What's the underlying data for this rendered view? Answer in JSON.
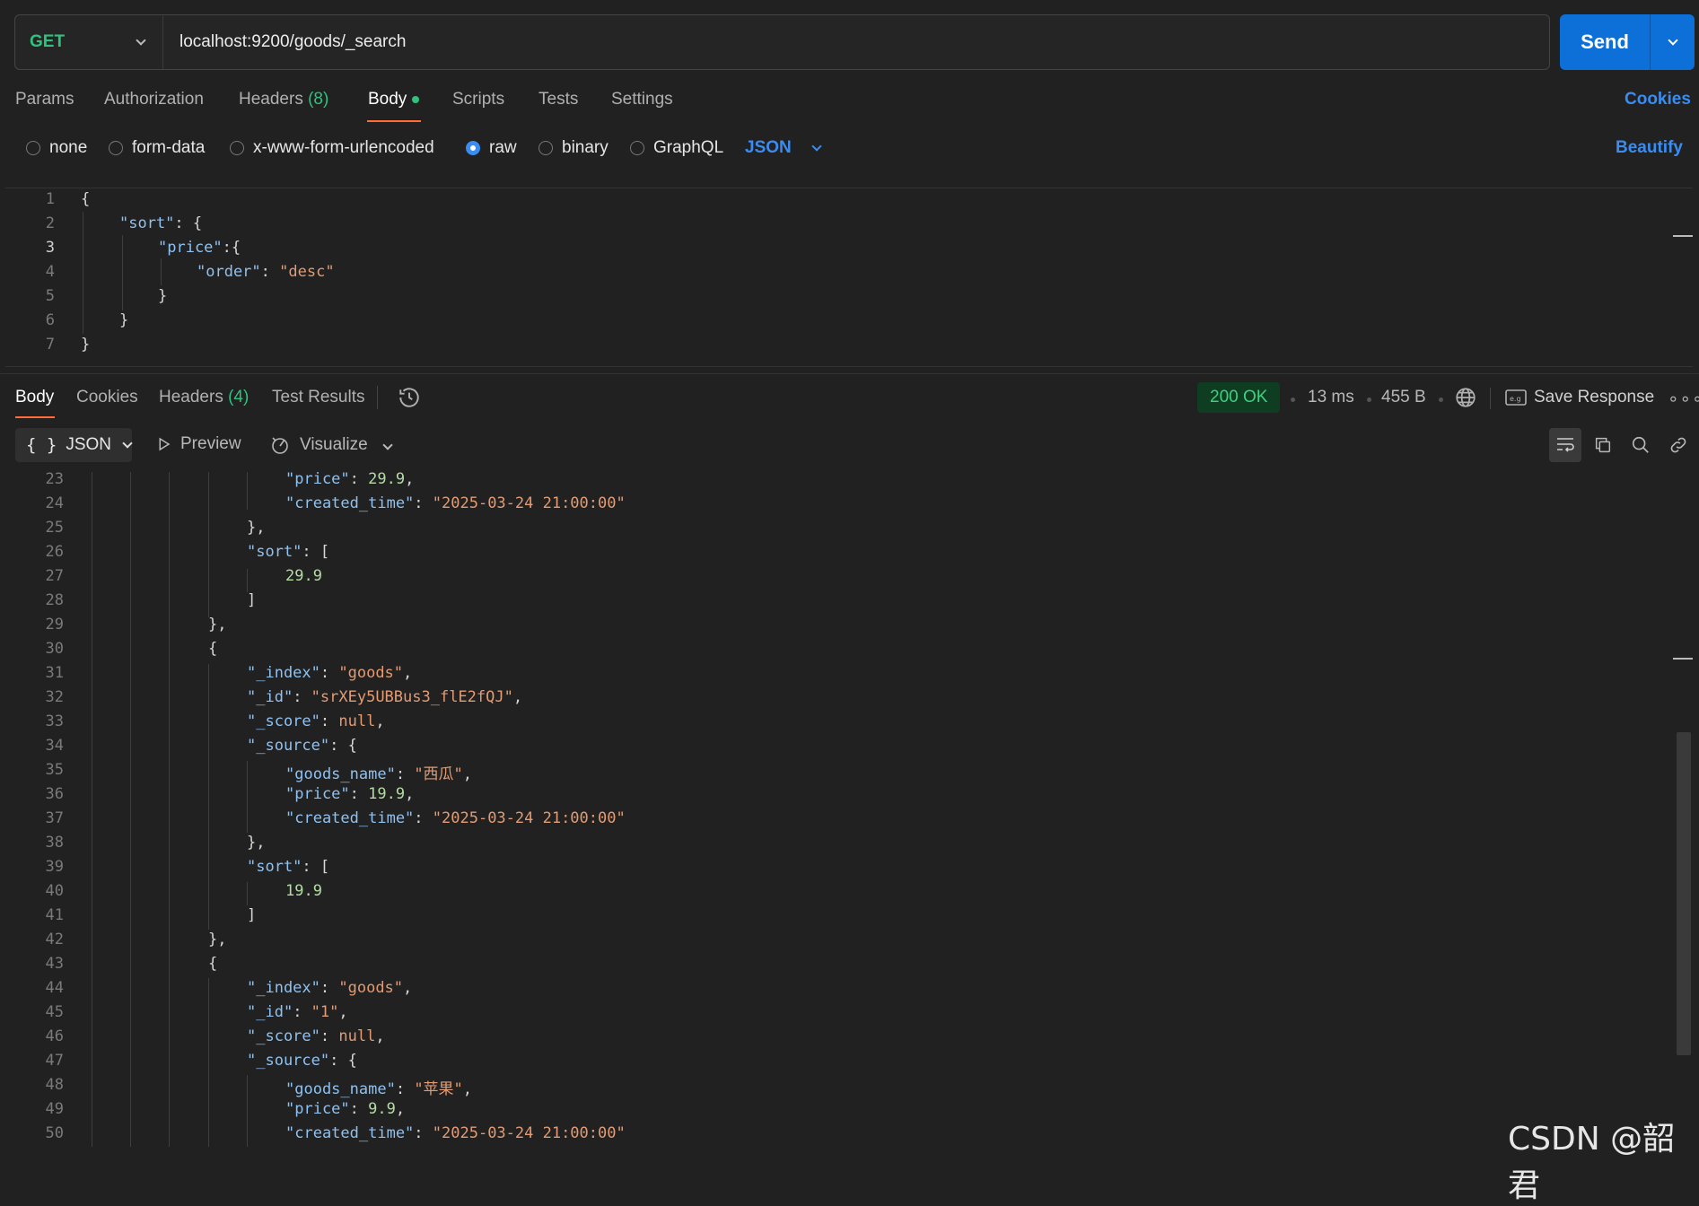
{
  "request": {
    "method": "GET",
    "url": "localhost:9200/goods/_search",
    "send_label": "Send"
  },
  "request_tabs": {
    "params": "Params",
    "authorization": "Authorization",
    "headers": "Headers",
    "headers_count": "(8)",
    "body": "Body",
    "scripts": "Scripts",
    "tests": "Tests",
    "settings": "Settings",
    "cookies": "Cookies"
  },
  "body_types": {
    "none": "none",
    "form_data": "form-data",
    "urlencoded": "x-www-form-urlencoded",
    "raw": "raw",
    "binary": "binary",
    "graphql": "GraphQL",
    "language": "JSON",
    "beautify": "Beautify"
  },
  "response_tabs": {
    "body": "Body",
    "cookies": "Cookies",
    "headers": "Headers",
    "headers_count": "(4)",
    "test_results": "Test Results"
  },
  "response_meta": {
    "status": "200 OK",
    "time": "13 ms",
    "size": "455 B",
    "save_response": "Save Response"
  },
  "response_toolbar": {
    "format": "JSON",
    "preview": "Preview",
    "visualize": "Visualize"
  },
  "watermark": "CSDN @韶君",
  "colors": {
    "accent_orange": "#ff6c37",
    "send_blue": "#0d6fd8",
    "status_green": "#3ecf7f",
    "key": "#8fc1f0",
    "string": "#e29b73",
    "number": "#b5dca4"
  }
}
